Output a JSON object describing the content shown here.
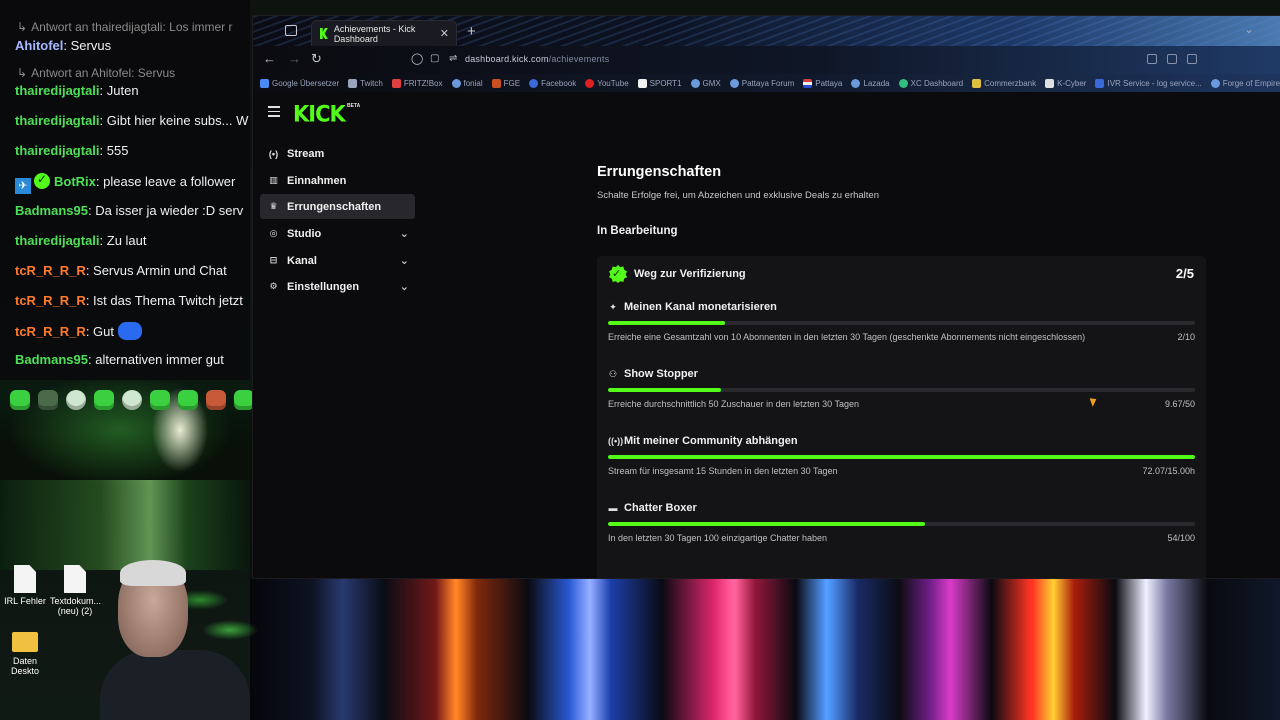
{
  "chat": {
    "lines": [
      {
        "type": "reply",
        "text": "Antwort an thairedijagtali: Los immer r"
      },
      {
        "type": "msg",
        "user": "Ahitofel",
        "text": ": Servus"
      },
      {
        "type": "reply",
        "text": "Antwort an Ahitofel: Servus"
      },
      {
        "type": "msg",
        "user": "thairedijagtali",
        "text": ": Juten"
      },
      {
        "type": "msg",
        "user": "thairedijagtali",
        "text": ": Gibt hier keine subs... W"
      },
      {
        "type": "msg",
        "user": "thairedijagtali",
        "text": ": 555"
      },
      {
        "type": "msg",
        "user": "BotRix",
        "text": ": please leave a follower"
      },
      {
        "type": "msg",
        "user": "Badmans95",
        "text": ": Da isser ja wieder :D serv"
      },
      {
        "type": "msg",
        "user": "thairedijagtali",
        "text": ": Zu laut"
      },
      {
        "type": "msg",
        "user": "tcR_R_R_R",
        "text": ": Servus Armin und Chat"
      },
      {
        "type": "msg",
        "user": "tcR_R_R_R",
        "text": ": Ist das Thema Twitch jetzt"
      },
      {
        "type": "msg",
        "user": "tcR_R_R_R",
        "text": ": Gut"
      },
      {
        "type": "msg",
        "user": "Badmans95",
        "text": ": alternativen immer gut"
      }
    ]
  },
  "desktop": {
    "icons": [
      {
        "label": "IRL Fehler"
      },
      {
        "label": "Textdokum... (neu) (2)"
      },
      {
        "label": "Daten Deskto"
      }
    ]
  },
  "browser": {
    "tab_title": "Achievements - Kick Dashboard",
    "tab_close": "✕",
    "new_tab": "+",
    "url_host": "dashboard.kick.com",
    "url_path": "/achievements",
    "bookmarks": [
      {
        "label": "Google Übersetzer",
        "color": "#4a8af4"
      },
      {
        "label": "Twitch",
        "color": "#9aa4bc"
      },
      {
        "label": "FRITZ!Box",
        "color": "#e04040"
      },
      {
        "label": "fonial",
        "color": "#6a9adc"
      },
      {
        "label": "FGE",
        "color": "#c85020"
      },
      {
        "label": "Facebook",
        "color": "#3a6ad8"
      },
      {
        "label": "YouTube",
        "color": "#e02020"
      },
      {
        "label": "SPORT1",
        "color": "#f0f0f0"
      },
      {
        "label": "GMX",
        "color": "#6a9adc"
      },
      {
        "label": "Pattaya Forum",
        "color": "#6a9adc"
      },
      {
        "label": "Pattaya",
        "color": "#d04040"
      },
      {
        "label": "Lazada",
        "color": "#6a9adc"
      },
      {
        "label": "XC Dashboard",
        "color": "#30c080"
      },
      {
        "label": "Commerzbank",
        "color": "#e0c040"
      },
      {
        "label": "K-Cyber",
        "color": "#e0e0e0"
      },
      {
        "label": "IVR Service - log service...",
        "color": "#3a6ad8"
      },
      {
        "label": "Forge of Empires",
        "color": "#6a9adc"
      }
    ]
  },
  "dashboard": {
    "logo": "KICK",
    "logo_badge": "BETA",
    "sidebar": [
      {
        "label": "Stream",
        "icon": "(•)",
        "active": false,
        "expandable": false
      },
      {
        "label": "Einnahmen",
        "icon": "▥",
        "active": false,
        "expandable": false
      },
      {
        "label": "Errungenschaften",
        "icon": "🏆",
        "active": true,
        "expandable": false
      },
      {
        "label": "Studio",
        "icon": "◎",
        "active": false,
        "expandable": true
      },
      {
        "label": "Kanal",
        "icon": "⊟",
        "active": false,
        "expandable": true
      },
      {
        "label": "Einstellungen",
        "icon": "⚙",
        "active": false,
        "expandable": true
      }
    ],
    "title": "Errungenschaften",
    "subtitle": "Schalte Erfolge frei, um Abzeichen und exklusive Deals zu erhalten",
    "section": "In Bearbeitung",
    "card": {
      "title": "Weg zur Verifizierung",
      "count": "2/5",
      "achievements": [
        {
          "icon": "✦",
          "name": "Meinen Kanal monetarisieren",
          "desc": "Erreiche eine Gesamtzahl von 10 Abonnenten in den letzten 30 Tagen (geschenkte Abonnements nicht eingeschlossen)",
          "value": "2/10",
          "progress": 0.2
        },
        {
          "icon": "⚇",
          "name": "Show Stopper",
          "desc": "Erreiche durchschnittlich 50 Zuschauer in den letzten 30 Tagen",
          "value": "9.67/50",
          "progress": 0.193
        },
        {
          "icon": "((•))",
          "name": "Mit meiner Community abhängen",
          "desc": "Stream für insgesamt 15 Stunden in den letzten 30 Tagen",
          "value": "72.07/15.00h",
          "progress": 1.0
        },
        {
          "icon": "▬",
          "name": "Chatter Boxer",
          "desc": "In den letzten 30 Tagen 100 einzigartige Chatter haben",
          "value": "54/100",
          "progress": 0.54
        }
      ]
    }
  },
  "colors": {
    "kick_green": "#53fc18",
    "panel": "#141417",
    "page_bg": "#0b0b0d"
  }
}
